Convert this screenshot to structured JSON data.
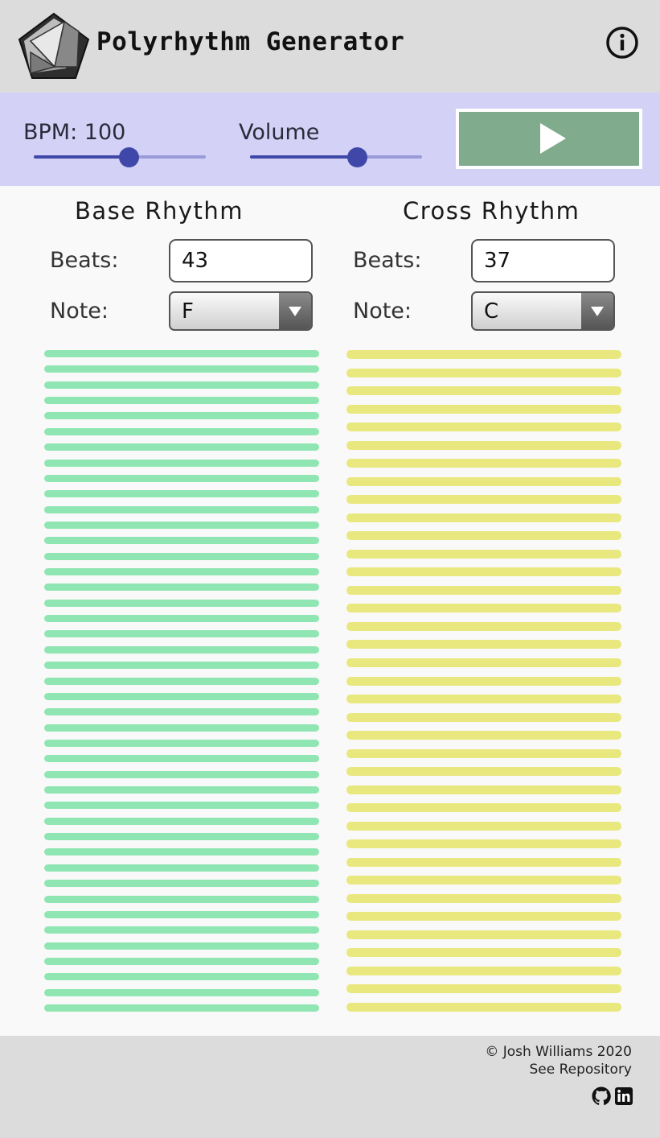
{
  "header": {
    "title": "Polyrhythm Generator",
    "logo_icon": "pentagon-logo-icon",
    "info_icon": "info-icon"
  },
  "controls": {
    "bpm_label": "BPM: 100",
    "bpm_value": 100,
    "bpm_fraction": 0.55,
    "volume_label": "Volume",
    "volume_fraction": 0.62,
    "play_icon": "play-icon",
    "play_button_color": "#80ab8c"
  },
  "base": {
    "title": "Base Rhythm",
    "beats_label": "Beats:",
    "beats_value": "43",
    "note_label": "Note:",
    "note_value": "F",
    "beat_count": 43,
    "color": "#90e6b3"
  },
  "cross": {
    "title": "Cross Rhythm",
    "beats_label": "Beats:",
    "beats_value": "37",
    "note_label": "Note:",
    "note_value": "C",
    "beat_count": 37,
    "color": "#e9e87e"
  },
  "footer": {
    "copyright": "© Josh Williams 2020",
    "repo_link": "See Repository",
    "github_icon": "github-icon",
    "linkedin_icon": "linkedin-icon"
  }
}
